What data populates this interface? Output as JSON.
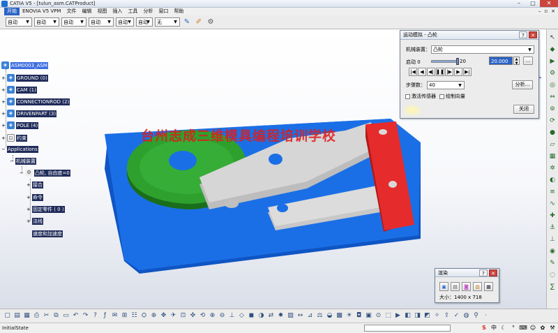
{
  "window": {
    "title": "CATIA V5 - [tulun_asm.CATProduct]",
    "controls": [
      "–",
      "□",
      "✕"
    ]
  },
  "menu": {
    "items": [
      "开始",
      "ENOVIA V5 VPM",
      "文件",
      "编辑",
      "视图",
      "插入",
      "工具",
      "分析",
      "窗口",
      "帮助"
    ],
    "mdi_controls": [
      "–",
      "▫",
      "×"
    ]
  },
  "toolbar": {
    "selects": [
      "自动",
      "自动",
      "自动",
      "自动",
      "自动",
      "自动",
      "无"
    ]
  },
  "tree": {
    "root": "ASM0003_ASM",
    "parts": [
      {
        "label": "GROUND (0)"
      },
      {
        "label": "CAM (1)"
      },
      {
        "label": "CONNECTIONROD (2)"
      },
      {
        "label": "DRIVENPART (3)"
      },
      {
        "label": "POLE (4)"
      }
    ],
    "constraints": "约束",
    "applications": "Applications",
    "mechanisms": "机械装置",
    "mechanism": "凸轮, 自由度=0",
    "children": [
      "接合",
      "命令",
      "固定零件 ( 0 )",
      "法线",
      "速度和加速度"
    ]
  },
  "watermark": "台州志成三维模具编程培训学校",
  "sim_dialog": {
    "title": "运动模拟 - 凸轮",
    "mechanism_label": "机械装置：",
    "mechanism_value": "凸轮",
    "drive_label": "启动 0",
    "slider_max": "20",
    "drive_value": "20.000",
    "drive_progress": 1.0,
    "more_button": "...",
    "playback_icons": [
      "skip-to-start",
      "step-back",
      "play-backward",
      "pause",
      "play-forward",
      "step-forward",
      "skip-to-end"
    ],
    "playback_glyphs": [
      "|◀",
      "◀",
      "◀|",
      "❚❚",
      "|▶",
      "▶",
      "▶|"
    ],
    "steps_label": "步骤数：",
    "steps_value": "40",
    "analysis_button": "分析...",
    "activate_sensors": "激活传感器",
    "plot_vectors": "绘制向量",
    "close_button": "关闭"
  },
  "render_dialog": {
    "title": "渲染",
    "size_text": "大小：1400 x 718"
  },
  "status": {
    "text": "InitialState"
  },
  "colors": {
    "base_plate": "#1b6fe6",
    "cam": "#2ea02e",
    "rod": "#c8c8c8",
    "pole": "#e52b2b",
    "tree_label_bg": "#1f2b59"
  }
}
